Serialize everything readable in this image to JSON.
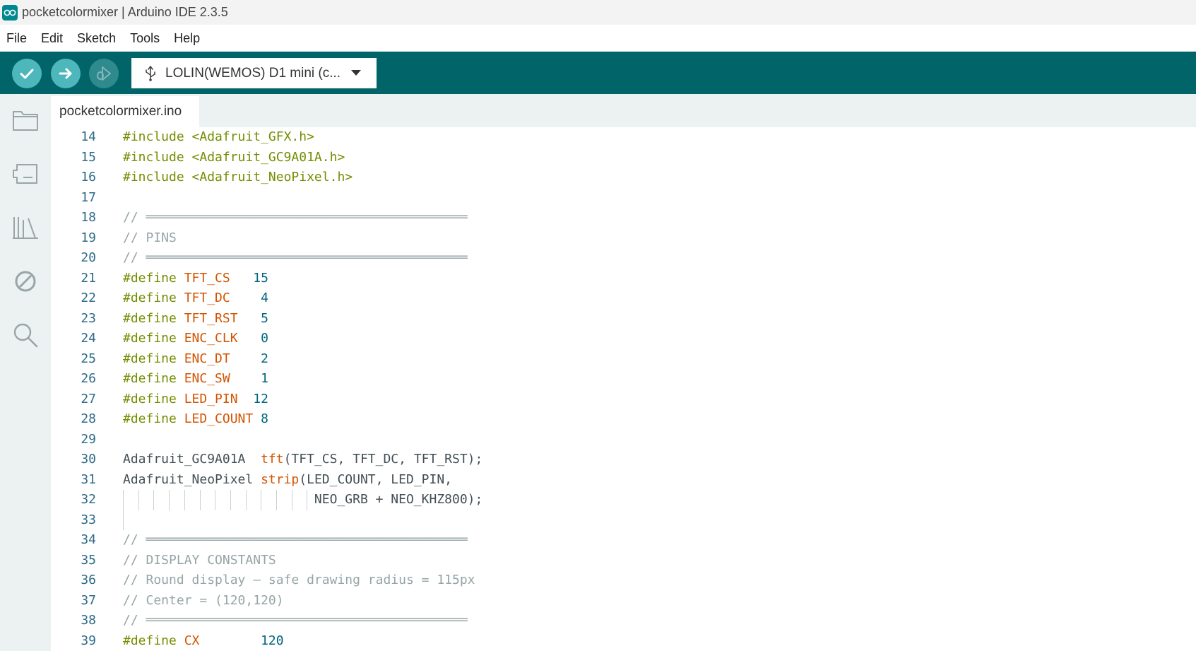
{
  "window": {
    "title": "pocketcolormixer | Arduino IDE 2.3.5"
  },
  "menu": [
    "File",
    "Edit",
    "Sketch",
    "Tools",
    "Help"
  ],
  "toolbar": {
    "board": "LOLIN(WEMOS) D1 mini (c..."
  },
  "tab": {
    "filename": "pocketcolormixer.ino"
  },
  "colors": {
    "toolbar": "#006468",
    "accent": "#4db7bb",
    "keyword": "#728e00",
    "macro": "#d35400",
    "comment": "#95a5a6"
  },
  "code": [
    {
      "n": "14",
      "parts": [
        [
          "kw",
          "#include"
        ],
        [
          "kw",
          " <Adafruit_GFX.h>"
        ]
      ]
    },
    {
      "n": "15",
      "parts": [
        [
          "kw",
          "#include"
        ],
        [
          "kw",
          " <Adafruit_GC9A01A.h>"
        ]
      ]
    },
    {
      "n": "16",
      "parts": [
        [
          "kw",
          "#include"
        ],
        [
          "kw",
          " <Adafruit_NeoPixel.h>"
        ]
      ]
    },
    {
      "n": "17",
      "parts": []
    },
    {
      "n": "18",
      "parts": [
        [
          "cm",
          "// ══════════════════════════════════════════"
        ]
      ]
    },
    {
      "n": "19",
      "parts": [
        [
          "cm",
          "// PINS"
        ]
      ]
    },
    {
      "n": "20",
      "parts": [
        [
          "cm",
          "// ══════════════════════════════════════════"
        ]
      ]
    },
    {
      "n": "21",
      "parts": [
        [
          "kw",
          "#define"
        ],
        [
          "",
          " "
        ],
        [
          "mac",
          "TFT_CS"
        ],
        [
          "",
          "   "
        ],
        [
          "num",
          "15"
        ]
      ]
    },
    {
      "n": "22",
      "parts": [
        [
          "kw",
          "#define"
        ],
        [
          "",
          " "
        ],
        [
          "mac",
          "TFT_DC"
        ],
        [
          "",
          "    "
        ],
        [
          "num",
          "4"
        ]
      ]
    },
    {
      "n": "23",
      "parts": [
        [
          "kw",
          "#define"
        ],
        [
          "",
          " "
        ],
        [
          "mac",
          "TFT_RST"
        ],
        [
          "",
          "   "
        ],
        [
          "num",
          "5"
        ]
      ]
    },
    {
      "n": "24",
      "parts": [
        [
          "kw",
          "#define"
        ],
        [
          "",
          " "
        ],
        [
          "mac",
          "ENC_CLK"
        ],
        [
          "",
          "   "
        ],
        [
          "num",
          "0"
        ]
      ]
    },
    {
      "n": "25",
      "parts": [
        [
          "kw",
          "#define"
        ],
        [
          "",
          " "
        ],
        [
          "mac",
          "ENC_DT"
        ],
        [
          "",
          "    "
        ],
        [
          "num",
          "2"
        ]
      ]
    },
    {
      "n": "26",
      "parts": [
        [
          "kw",
          "#define"
        ],
        [
          "",
          " "
        ],
        [
          "mac",
          "ENC_SW"
        ],
        [
          "",
          "    "
        ],
        [
          "num",
          "1"
        ]
      ]
    },
    {
      "n": "27",
      "parts": [
        [
          "kw",
          "#define"
        ],
        [
          "",
          " "
        ],
        [
          "mac",
          "LED_PIN"
        ],
        [
          "",
          "  "
        ],
        [
          "num",
          "12"
        ]
      ]
    },
    {
      "n": "28",
      "parts": [
        [
          "kw",
          "#define"
        ],
        [
          "",
          " "
        ],
        [
          "mac",
          "LED_COUNT"
        ],
        [
          "",
          " "
        ],
        [
          "num",
          "8"
        ]
      ]
    },
    {
      "n": "29",
      "parts": []
    },
    {
      "n": "30",
      "parts": [
        [
          "typ",
          "Adafruit_GC9A01A"
        ],
        [
          "",
          "  "
        ],
        [
          "fn",
          "tft"
        ],
        [
          "",
          "(TFT_CS, TFT_DC, TFT_RST);"
        ]
      ]
    },
    {
      "n": "31",
      "parts": [
        [
          "typ",
          "Adafruit_NeoPixel"
        ],
        [
          "",
          " "
        ],
        [
          "fn",
          "strip"
        ],
        [
          "",
          "(LED_COUNT, LED_PIN,"
        ]
      ]
    },
    {
      "n": "32",
      "parts": [
        [
          "",
          "                         NEO_GRB + NEO_KHZ800);"
        ]
      ],
      "guides": 13
    },
    {
      "n": "33",
      "parts": [],
      "guides": 1
    },
    {
      "n": "34",
      "parts": [
        [
          "cm",
          "// ══════════════════════════════════════════"
        ]
      ]
    },
    {
      "n": "35",
      "parts": [
        [
          "cm",
          "// DISPLAY CONSTANTS"
        ]
      ]
    },
    {
      "n": "36",
      "parts": [
        [
          "cm",
          "// Round display — safe drawing radius = 115px"
        ]
      ]
    },
    {
      "n": "37",
      "parts": [
        [
          "cm",
          "// Center = (120,120)"
        ]
      ]
    },
    {
      "n": "38",
      "parts": [
        [
          "cm",
          "// ══════════════════════════════════════════"
        ]
      ]
    },
    {
      "n": "39",
      "parts": [
        [
          "kw",
          "#define"
        ],
        [
          "",
          " "
        ],
        [
          "mac",
          "CX"
        ],
        [
          "",
          "        "
        ],
        [
          "num",
          "120"
        ]
      ]
    }
  ]
}
